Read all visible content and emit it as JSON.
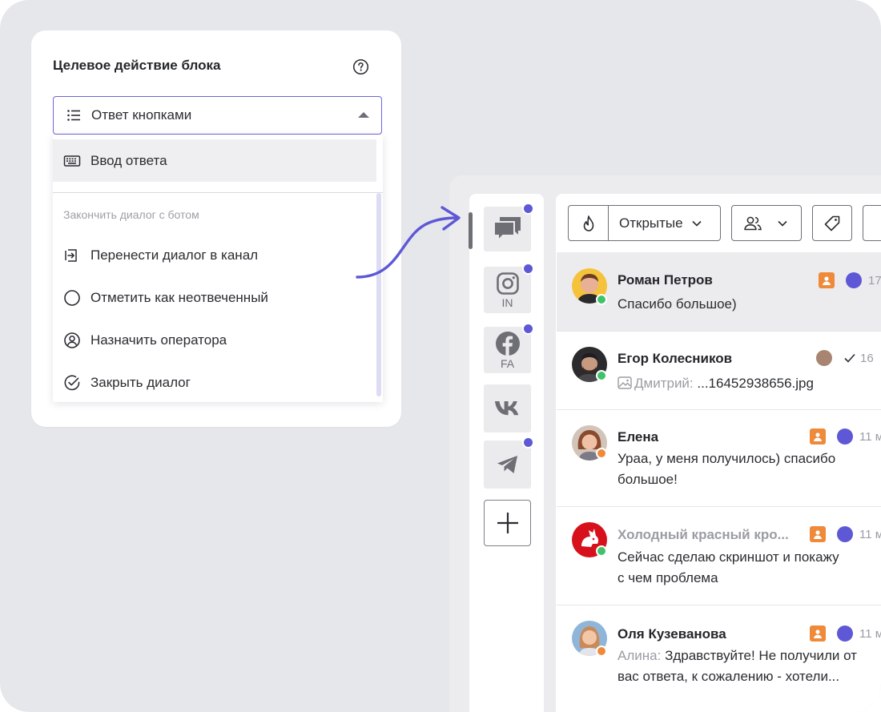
{
  "block_settings": {
    "title": "Целевое действие блока",
    "selected_action": "Ответ кнопками",
    "dropdown": {
      "top_item": "Ввод ответа",
      "section_title": "Закончить диалог с ботом",
      "items": [
        {
          "label": "Перенести диалог в канал",
          "icon": "transfer-icon"
        },
        {
          "label": "Отметить как неотвеченный",
          "icon": "circle-icon"
        },
        {
          "label": "Назначить оператора",
          "icon": "user-circle-icon"
        },
        {
          "label": "Закрыть диалог",
          "icon": "check-circle-icon"
        }
      ]
    }
  },
  "channels": [
    {
      "name": "chats",
      "label": "",
      "icon": "chat-bubbles-icon",
      "has_unread": true
    },
    {
      "name": "instagram",
      "label": "IN",
      "icon": "instagram-icon",
      "has_unread": true
    },
    {
      "name": "facebook",
      "label": "FA",
      "icon": "facebook-icon",
      "has_unread": true
    },
    {
      "name": "vk",
      "label": "",
      "icon": "vk-icon",
      "has_unread": false
    },
    {
      "name": "telegram",
      "label": "",
      "icon": "telegram-icon",
      "has_unread": true
    }
  ],
  "toolbar": {
    "filter_label": "Открытые"
  },
  "conversations": [
    {
      "name": "Роман Петров",
      "message": "Спасибо большое)",
      "time": "17",
      "status": "green"
    },
    {
      "name": "Егор Колесников",
      "prefix": "Дмитрий:",
      "message": "...16452938656.jpg",
      "time": "16",
      "status": "green"
    },
    {
      "name": "Елена",
      "message_lines": [
        "Ураа, у меня получилось) спасибо",
        "большое!"
      ],
      "time": "11 м",
      "status": "orange"
    },
    {
      "name": "Холодный красный кро...",
      "message_lines": [
        "Сейчас сделаю скриншот и покажу",
        "с чем проблема"
      ],
      "time": "11 м",
      "status": "green"
    },
    {
      "name": "Оля Кузеванова",
      "prefix": "Алина:",
      "message_lines": [
        "Здравствуйте! Не получили от",
        "вас ответа, к сожалению - хотели..."
      ],
      "time": "11 м",
      "status": "orange"
    }
  ],
  "colors": {
    "accent": "#5e58d6",
    "badge_orange": "#ee8a3a",
    "online": "#3fc36a"
  }
}
